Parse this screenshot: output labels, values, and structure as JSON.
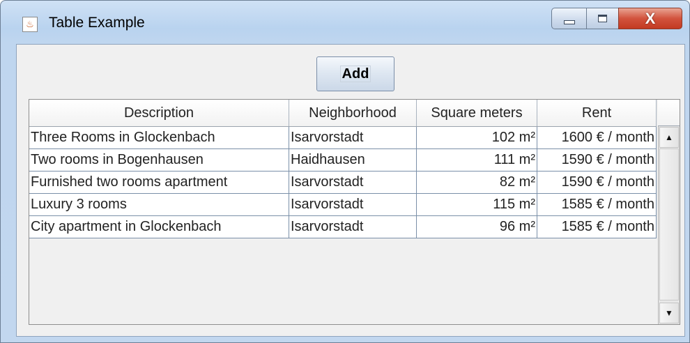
{
  "window": {
    "title": "Table Example",
    "app_icon": "java-cup-icon",
    "controls": {
      "minimize": "minimize-icon",
      "maximize": "maximize-icon",
      "close": "close-icon"
    }
  },
  "toolbar": {
    "add_label": "Add"
  },
  "table": {
    "columns": [
      "Description",
      "Neighborhood",
      "Square meters",
      "Rent"
    ],
    "rows": [
      [
        "Three Rooms in Glockenbach",
        "Isarvorstadt",
        "102 m²",
        "1600 € / month"
      ],
      [
        "Two rooms in Bogenhausen",
        "Haidhausen",
        "111 m²",
        "1590 € / month"
      ],
      [
        "Furnished two rooms apartment",
        "Isarvorstadt",
        "82 m²",
        "1590 € / month"
      ],
      [
        "Luxury 3 rooms",
        "Isarvorstadt",
        "115 m²",
        "1585 € / month"
      ],
      [
        "City apartment in Glockenbach",
        "Isarvorstadt",
        "96 m²",
        "1585 € / month"
      ]
    ]
  },
  "colors": {
    "window_frame": "#bfd6ef",
    "close_button": "#c94630",
    "grid_line": "#7a8fa8"
  }
}
